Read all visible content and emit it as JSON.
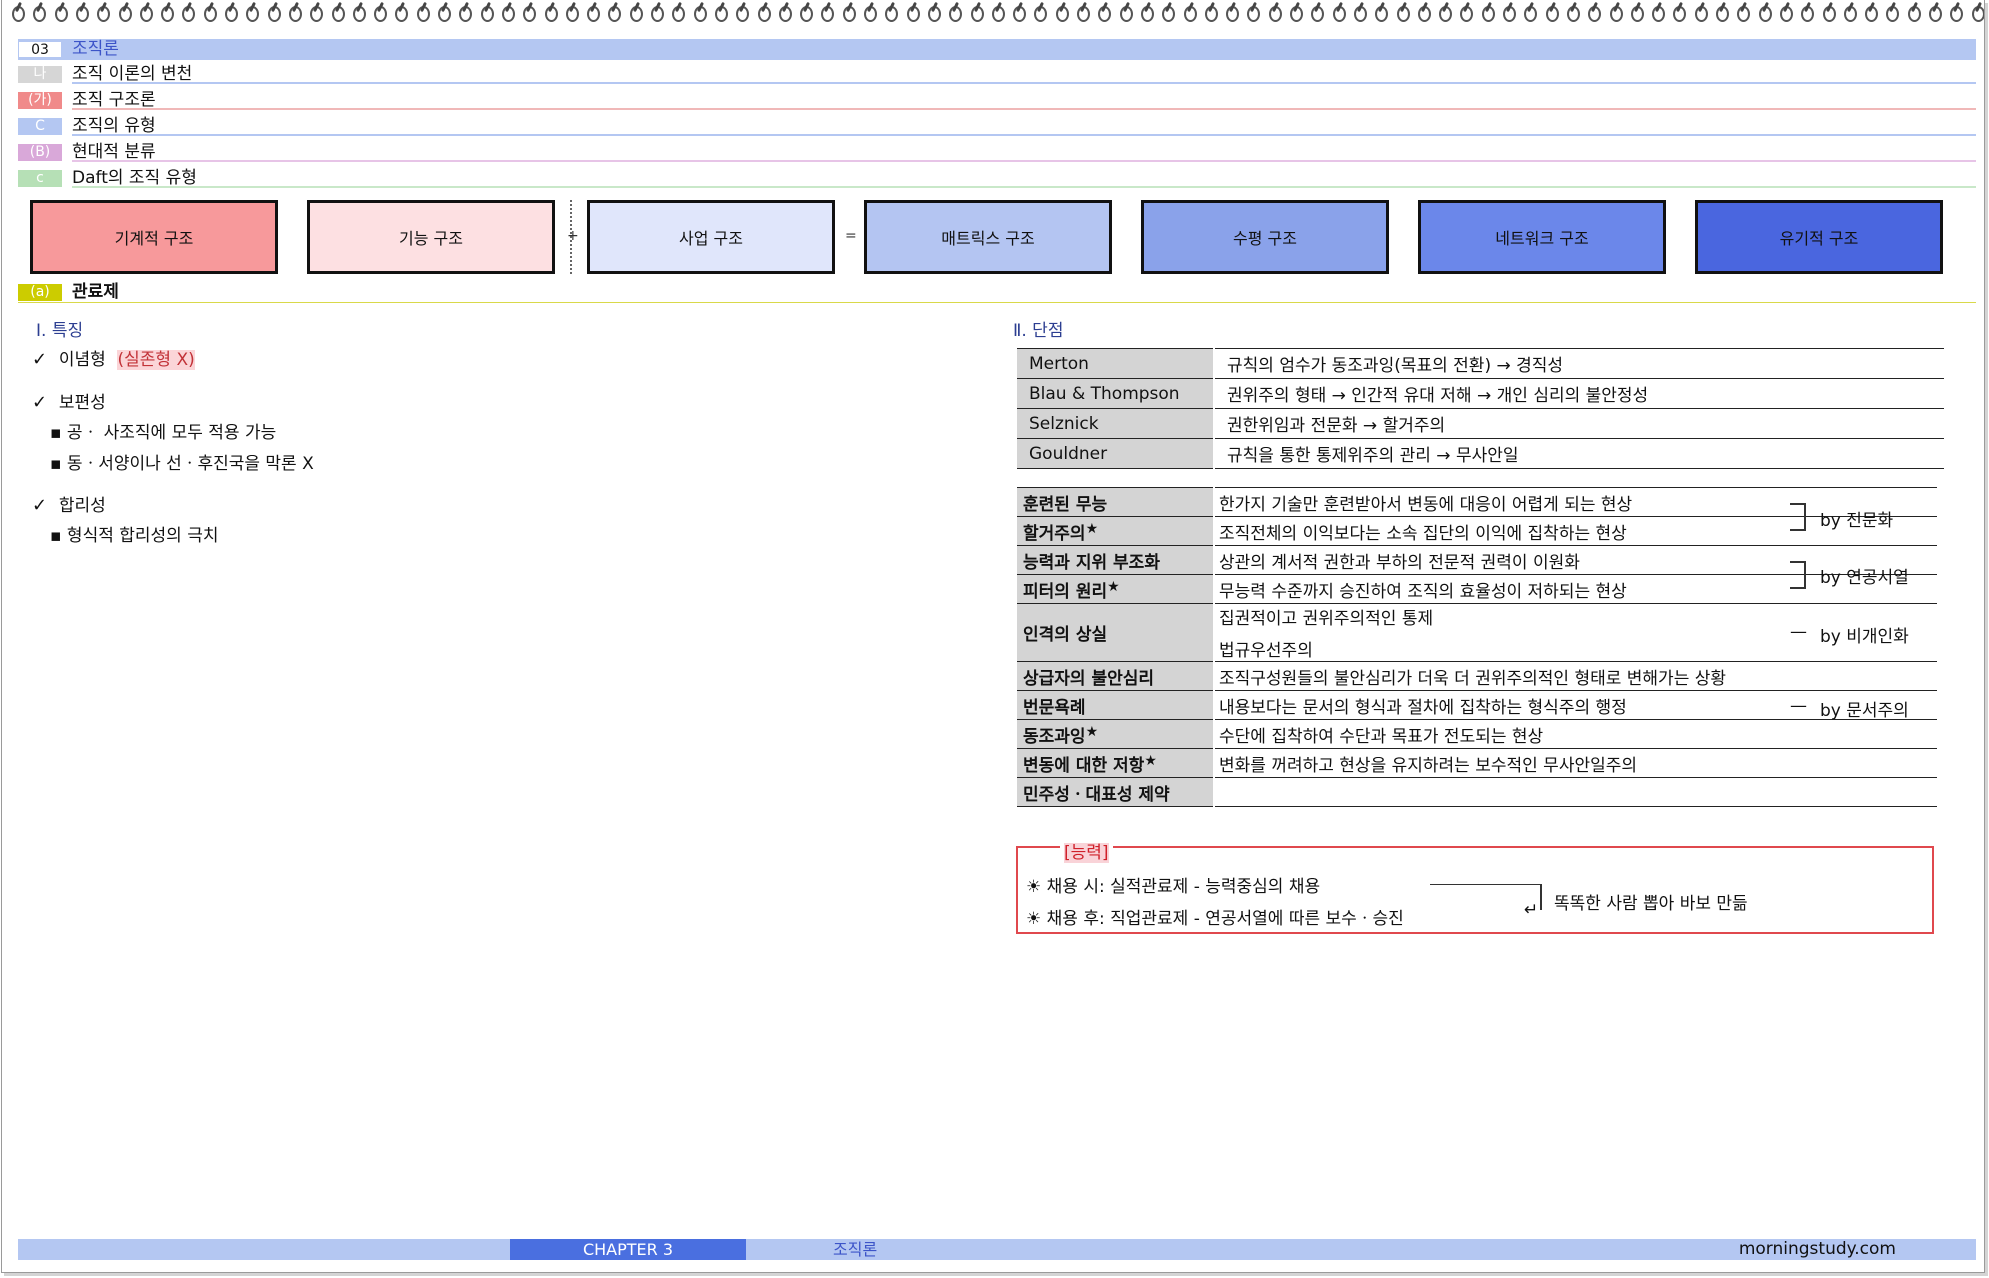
{
  "headings": [
    {
      "badge": "03",
      "text": "조직론",
      "badge_bg": "#ffffff",
      "badge_color": "#111111",
      "text_color": "#3c54c8",
      "bar": "#b4c7f2"
    },
    {
      "badge": "나",
      "text": "조직 이론의 변천",
      "badge_bg": "#d6d6d6",
      "badge_color": "#ffffff",
      "text_color": "#111111",
      "line": "#b4c7f2"
    },
    {
      "badge": "(가)",
      "text": "조직 구조론",
      "badge_bg": "#f08a8a",
      "badge_color": "#ffffff",
      "text_color": "#111111",
      "line": "#f0b8b8"
    },
    {
      "badge": "C",
      "text": "조직의 유형",
      "badge_bg": "#b4c7f2",
      "badge_color": "#ffffff",
      "text_color": "#111111",
      "line": "#b4c7f2"
    },
    {
      "badge": "(B)",
      "text": "현대적 분류",
      "badge_bg": "#d9a8d9",
      "badge_color": "#ffffff",
      "text_color": "#111111",
      "line": "#e7c4e7"
    },
    {
      "badge": "c",
      "text": "Daft의 조직 유형",
      "badge_bg": "#b6e0b6",
      "badge_color": "#ffffff",
      "text_color": "#111111",
      "line": "#c9e8c9"
    }
  ],
  "structures": [
    {
      "label": "기계적 구조",
      "color": "#f7999b"
    },
    {
      "label": "기능 구조",
      "color": "#fde0e2"
    },
    {
      "label": "사업 구조",
      "color": "#e0e6fb"
    },
    {
      "label": "매트릭스 구조",
      "color": "#b4c5f2"
    },
    {
      "label": "수평 구조",
      "color": "#8aa2ea"
    },
    {
      "label": "네트워크 구조",
      "color": "#6b87ea"
    },
    {
      "label": "유기적 구조",
      "color": "#4a66df"
    }
  ],
  "ops": {
    "plus": "+",
    "equals": "="
  },
  "subheading": {
    "badge": "(a)",
    "text": "관료제",
    "badge_bg": "#cccc00",
    "line": "#d9d94a"
  },
  "left": {
    "title": "Ⅰ. 특징",
    "checks": [
      {
        "mark": "✓",
        "text": "이념형",
        "highlight": "(실존형 X)"
      },
      {
        "mark": "✓",
        "text": "보편성"
      },
      {
        "mark": "✓",
        "text": "합리성"
      }
    ],
    "bullets_universal": [
      "▪ 공ㆍ 사조직에 모두 적용 가능",
      "▪ 동ㆍ서양이나 선ㆍ후진국을 막론   X"
    ],
    "bullets_rational": [
      "▪ 형식적 합리성의 극치"
    ]
  },
  "right": {
    "title": "Ⅱ. 단점",
    "table1": [
      {
        "k": "Merton",
        "v": "규칙의 엄수가 동조과잉(목표의 전환) → 경직성"
      },
      {
        "k": "Blau & Thompson",
        "v": "권위주의 형태 →  인간적 유대 저해 → 개인 심리의 불안정성"
      },
      {
        "k": "Selznick",
        "v": "권한위임과 전문화 → 할거주의"
      },
      {
        "k": "Gouldner",
        "v": "규칙을 통한 통제위주의 관리 → 무사안일"
      }
    ],
    "table2": [
      {
        "k": "훈련된 무능",
        "v": "한가지 기술만 훈련받아서 변동에 대응이 어렵게 되는 현상"
      },
      {
        "k": "할거주의",
        "star": "★",
        "v": "조직전체의 이익보다는 소속 집단의 이익에 집착하는 현상"
      },
      {
        "k": "능력과 지위 부조화",
        "v": "상관의 계서적 권한과 부하의 전문적 권력이 이원화"
      },
      {
        "k": "피터의 원리",
        "star": "★",
        "v": "무능력 수준까지 승진하여 조직의 효율성이 저하되는 현상"
      },
      {
        "k": "인격의 상실",
        "v": "집권적이고 권위주의적인 통제",
        "v2": "법규우선주의"
      },
      {
        "k": "상급자의 불안심리",
        "v": "조직구성원들의 불안심리가 더욱 더 권위주의적인 형태로 변해가는 상황"
      },
      {
        "k": "번문욕례",
        "v": "내용보다는 문서의 형식과 절차에 집착하는 형식주의 행정"
      },
      {
        "k": "동조과잉",
        "star": "★",
        "v": "수단에 집착하여 수단과 목표가 전도되는 현상"
      },
      {
        "k": "변동에 대한 저항",
        "star": "★",
        "v": "변화를 꺼려하고 현상을 유지하려는 보수적인 무사안일주의"
      },
      {
        "k": "민주성ㆍ대표성 제약",
        "v": ""
      }
    ],
    "by_labels": {
      "expertise": "by 전문화",
      "seniority": "by 연공서열",
      "impersonal": "by 비개인화",
      "paper": "by 문서주의",
      "dash": "—"
    },
    "ability": {
      "legend": "[능력]",
      "line1": "☀ 채용 시: 실적관료제 - 능력중심의 채용",
      "line2": "☀ 채용 후: 직업관료제 - 연공서열에 따른 보수ㆍ승진",
      "arrow": "↵",
      "result": "똑똑한 사람 뽑아 바보 만듦"
    }
  },
  "footer": {
    "chapter": "CHAPTER  3",
    "title": "조직론",
    "site": "morningstudy.com"
  }
}
